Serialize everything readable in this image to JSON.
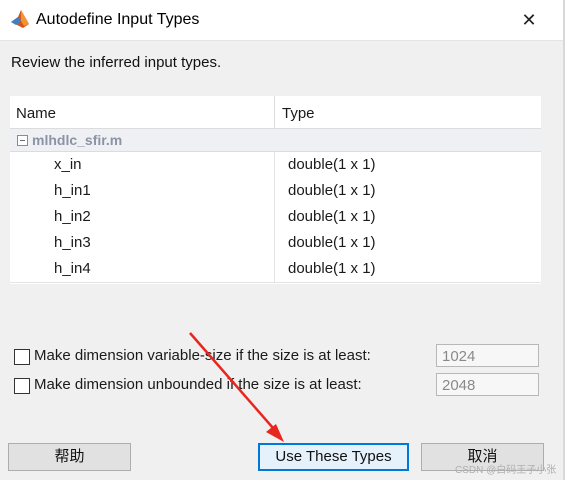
{
  "window": {
    "title": "Autodefine Input Types",
    "close_glyph": "✕"
  },
  "prompt": "Review the inferred input types.",
  "table": {
    "headers": {
      "name": "Name",
      "type": "Type"
    },
    "group": {
      "label": "mlhdlc_sfir.m",
      "icon": "collapse-minus-icon"
    },
    "rows": [
      {
        "name": "x_in",
        "type": "double(1 x 1)"
      },
      {
        "name": "h_in1",
        "type": "double(1 x 1)"
      },
      {
        "name": "h_in2",
        "type": "double(1 x 1)"
      },
      {
        "name": "h_in3",
        "type": "double(1 x 1)"
      },
      {
        "name": "h_in4",
        "type": "double(1 x 1)"
      }
    ]
  },
  "options": [
    {
      "label": "Make dimension variable-size if the size is at least:",
      "value": "1024",
      "checked": false
    },
    {
      "label": "Make dimension unbounded if the size is at least:",
      "value": "2048",
      "checked": false
    }
  ],
  "buttons": {
    "help": "帮助",
    "use_types": "Use These Types",
    "cancel": "取消"
  },
  "watermark": "CSDN @白码王子小张",
  "colors": {
    "accent": "#0078d7",
    "annotation_arrow": "#e8251f"
  }
}
